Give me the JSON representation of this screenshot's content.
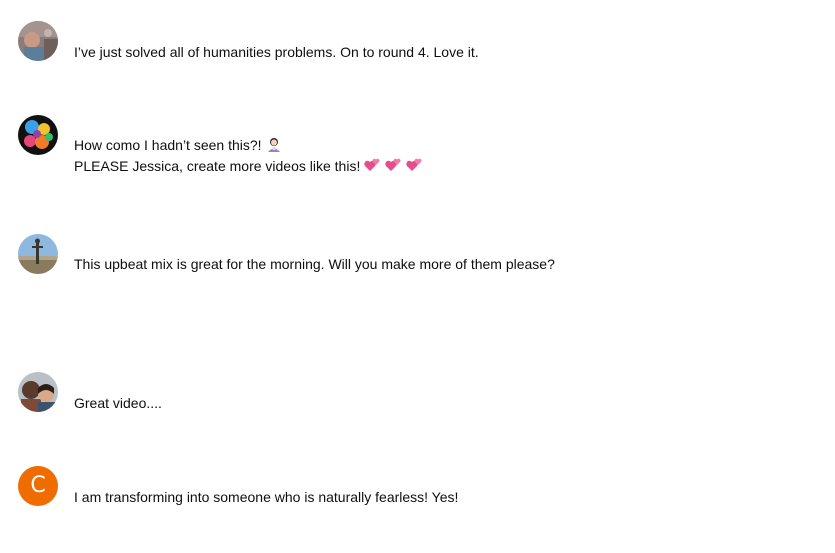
{
  "comments": [
    {
      "avatar_icon": "user-photo-avatar",
      "lines": [
        "I’ve just solved all of humanities problems. On to round 4. Love it."
      ]
    },
    {
      "avatar_icon": "colorful-art-avatar",
      "lines": [
        "How como I hadn’t seen this?!",
        "PLEASE Jessica, create more videos like this!"
      ],
      "line_emojis": [
        "person-shrugging-emoji",
        "two-hearts-emoji"
      ]
    },
    {
      "avatar_icon": "landscape-photo-avatar",
      "lines": [
        "This upbeat mix is great for the morning. Will you make more of them please?"
      ]
    },
    {
      "avatar_icon": "couple-photo-avatar",
      "lines": [
        "Great video...."
      ]
    },
    {
      "avatar_icon": "letter-avatar",
      "avatar_letter": "C",
      "avatar_color": "#ef6c00",
      "lines": [
        "I am transforming into someone who is naturally fearless! Yes!"
      ]
    }
  ]
}
